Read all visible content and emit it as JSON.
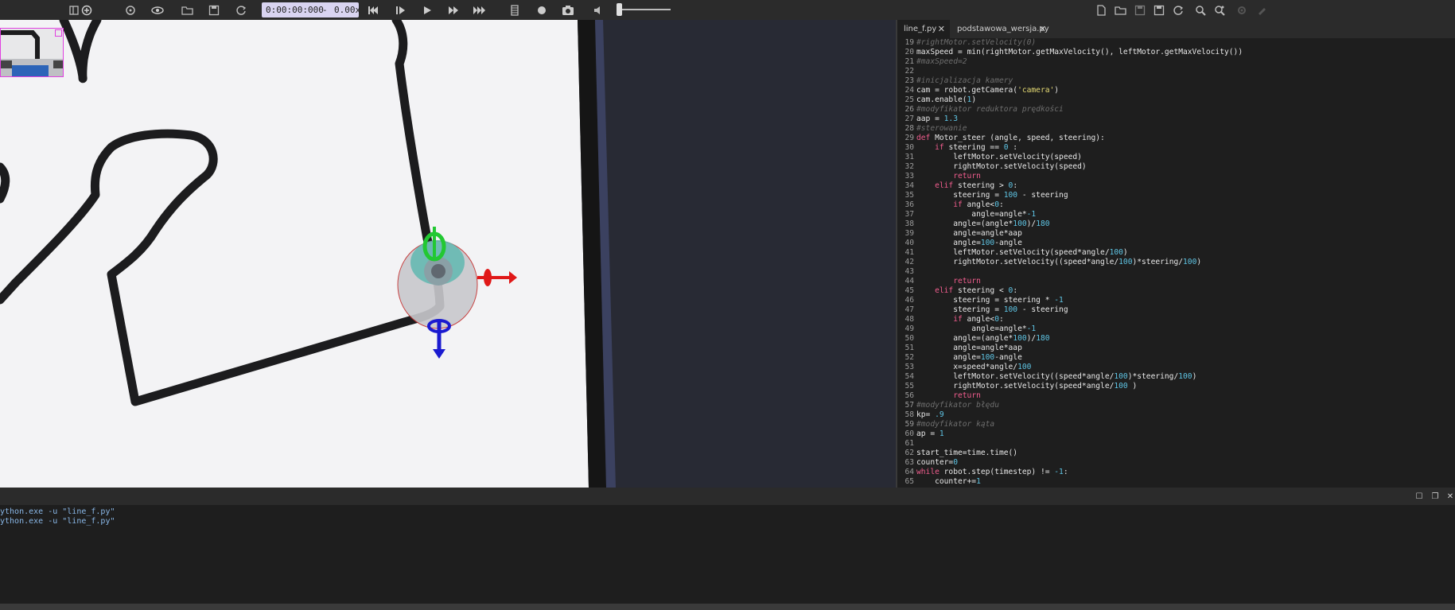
{
  "toolbar": {
    "time_display": "0:00:00:000",
    "time_sep": "-",
    "speed_display": "0.00x"
  },
  "tabs": [
    {
      "label": "line_f.py",
      "active": true
    },
    {
      "label": "podstawowa_wersja.py",
      "active": false
    }
  ],
  "code": [
    {
      "n": "19",
      "parts": [
        {
          "t": "#rightMotor.setVelocity(0)",
          "c": "comment"
        }
      ]
    },
    {
      "n": "20",
      "parts": [
        {
          "t": "maxSpeed = min(rightMotor.getMaxVelocity(), leftMotor.getMaxVelocity())",
          "c": ""
        }
      ]
    },
    {
      "n": "21",
      "parts": [
        {
          "t": "#maxSpeed=2",
          "c": "comment"
        }
      ]
    },
    {
      "n": "22",
      "parts": []
    },
    {
      "n": "23",
      "parts": [
        {
          "t": "#inicjalizacja kamery",
          "c": "comment"
        }
      ]
    },
    {
      "n": "24",
      "parts": [
        {
          "t": "cam = robot.getCamera(",
          "c": ""
        },
        {
          "t": "'camera'",
          "c": "str"
        },
        {
          "t": ")",
          "c": ""
        }
      ]
    },
    {
      "n": "25",
      "parts": [
        {
          "t": "cam.enable(",
          "c": ""
        },
        {
          "t": "1",
          "c": "num"
        },
        {
          "t": ")",
          "c": ""
        }
      ]
    },
    {
      "n": "26",
      "parts": [
        {
          "t": "#modyfikator reduktora prędkości",
          "c": "comment"
        }
      ]
    },
    {
      "n": "27",
      "parts": [
        {
          "t": "aap = ",
          "c": ""
        },
        {
          "t": "1.3",
          "c": "num"
        }
      ]
    },
    {
      "n": "28",
      "parts": [
        {
          "t": "#sterowanie",
          "c": "comment"
        }
      ]
    },
    {
      "n": "29",
      "parts": [
        {
          "t": "def ",
          "c": "kw"
        },
        {
          "t": "Motor_steer (angle, speed, steering):",
          "c": ""
        }
      ]
    },
    {
      "n": "30",
      "parts": [
        {
          "t": "    ",
          "c": ""
        },
        {
          "t": "if ",
          "c": "kw"
        },
        {
          "t": "steering == ",
          "c": ""
        },
        {
          "t": "0",
          "c": "num"
        },
        {
          "t": " :",
          "c": ""
        }
      ]
    },
    {
      "n": "31",
      "parts": [
        {
          "t": "        leftMotor.setVelocity(speed)",
          "c": ""
        }
      ]
    },
    {
      "n": "32",
      "parts": [
        {
          "t": "        rightMotor.setVelocity(speed)",
          "c": ""
        }
      ]
    },
    {
      "n": "33",
      "parts": [
        {
          "t": "        ",
          "c": ""
        },
        {
          "t": "return",
          "c": "kw"
        }
      ]
    },
    {
      "n": "34",
      "parts": [
        {
          "t": "    ",
          "c": ""
        },
        {
          "t": "elif ",
          "c": "kw"
        },
        {
          "t": "steering > ",
          "c": ""
        },
        {
          "t": "0",
          "c": "num"
        },
        {
          "t": ":",
          "c": ""
        }
      ]
    },
    {
      "n": "35",
      "parts": [
        {
          "t": "        steering = ",
          "c": ""
        },
        {
          "t": "100",
          "c": "num"
        },
        {
          "t": " - steering",
          "c": ""
        }
      ]
    },
    {
      "n": "36",
      "parts": [
        {
          "t": "        ",
          "c": ""
        },
        {
          "t": "if ",
          "c": "kw"
        },
        {
          "t": "angle<",
          "c": ""
        },
        {
          "t": "0",
          "c": "num"
        },
        {
          "t": ":",
          "c": ""
        }
      ]
    },
    {
      "n": "37",
      "parts": [
        {
          "t": "            angle=angle*",
          "c": ""
        },
        {
          "t": "-1",
          "c": "num"
        }
      ]
    },
    {
      "n": "38",
      "parts": [
        {
          "t": "        angle=(angle*",
          "c": ""
        },
        {
          "t": "100",
          "c": "num"
        },
        {
          "t": ")/",
          "c": ""
        },
        {
          "t": "180",
          "c": "num"
        }
      ]
    },
    {
      "n": "39",
      "parts": [
        {
          "t": "        angle=angle*aap",
          "c": ""
        }
      ]
    },
    {
      "n": "40",
      "parts": [
        {
          "t": "        angle=",
          "c": ""
        },
        {
          "t": "100",
          "c": "num"
        },
        {
          "t": "-angle",
          "c": ""
        }
      ]
    },
    {
      "n": "41",
      "parts": [
        {
          "t": "        leftMotor.setVelocity(speed*angle/",
          "c": ""
        },
        {
          "t": "100",
          "c": "num"
        },
        {
          "t": ")",
          "c": ""
        }
      ]
    },
    {
      "n": "42",
      "parts": [
        {
          "t": "        rightMotor.setVelocity((speed*angle/",
          "c": ""
        },
        {
          "t": "100",
          "c": "num"
        },
        {
          "t": ")*steering/",
          "c": ""
        },
        {
          "t": "100",
          "c": "num"
        },
        {
          "t": ")",
          "c": ""
        }
      ]
    },
    {
      "n": "43",
      "parts": []
    },
    {
      "n": "44",
      "parts": [
        {
          "t": "        ",
          "c": ""
        },
        {
          "t": "return",
          "c": "kw"
        }
      ]
    },
    {
      "n": "45",
      "parts": [
        {
          "t": "    ",
          "c": ""
        },
        {
          "t": "elif ",
          "c": "kw"
        },
        {
          "t": "steering < ",
          "c": ""
        },
        {
          "t": "0",
          "c": "num"
        },
        {
          "t": ":",
          "c": ""
        }
      ]
    },
    {
      "n": "46",
      "parts": [
        {
          "t": "        steering = steering * ",
          "c": ""
        },
        {
          "t": "-1",
          "c": "num"
        }
      ]
    },
    {
      "n": "47",
      "parts": [
        {
          "t": "        steering = ",
          "c": ""
        },
        {
          "t": "100",
          "c": "num"
        },
        {
          "t": " - steering",
          "c": ""
        }
      ]
    },
    {
      "n": "48",
      "parts": [
        {
          "t": "        ",
          "c": ""
        },
        {
          "t": "if ",
          "c": "kw"
        },
        {
          "t": "angle<",
          "c": ""
        },
        {
          "t": "0",
          "c": "num"
        },
        {
          "t": ":",
          "c": ""
        }
      ]
    },
    {
      "n": "49",
      "parts": [
        {
          "t": "            angle=angle*",
          "c": ""
        },
        {
          "t": "-1",
          "c": "num"
        }
      ]
    },
    {
      "n": "50",
      "parts": [
        {
          "t": "        angle=(angle*",
          "c": ""
        },
        {
          "t": "100",
          "c": "num"
        },
        {
          "t": ")/",
          "c": ""
        },
        {
          "t": "180",
          "c": "num"
        }
      ]
    },
    {
      "n": "51",
      "parts": [
        {
          "t": "        angle=angle*aap",
          "c": ""
        }
      ]
    },
    {
      "n": "52",
      "parts": [
        {
          "t": "        angle=",
          "c": ""
        },
        {
          "t": "100",
          "c": "num"
        },
        {
          "t": "-angle",
          "c": ""
        }
      ]
    },
    {
      "n": "53",
      "parts": [
        {
          "t": "        x=speed*angle/",
          "c": ""
        },
        {
          "t": "100",
          "c": "num"
        }
      ]
    },
    {
      "n": "54",
      "parts": [
        {
          "t": "        leftMotor.setVelocity((speed*angle/",
          "c": ""
        },
        {
          "t": "100",
          "c": "num"
        },
        {
          "t": ")*steering/",
          "c": ""
        },
        {
          "t": "100",
          "c": "num"
        },
        {
          "t": ")",
          "c": ""
        }
      ]
    },
    {
      "n": "55",
      "parts": [
        {
          "t": "        rightMotor.setVelocity(speed*angle/",
          "c": ""
        },
        {
          "t": "100",
          "c": "num"
        },
        {
          "t": " )",
          "c": ""
        }
      ]
    },
    {
      "n": "56",
      "parts": [
        {
          "t": "        ",
          "c": ""
        },
        {
          "t": "return",
          "c": "kw"
        }
      ]
    },
    {
      "n": "57",
      "parts": [
        {
          "t": "#modyfikator błędu",
          "c": "comment"
        }
      ]
    },
    {
      "n": "58",
      "parts": [
        {
          "t": "kp= ",
          "c": ""
        },
        {
          "t": ".9",
          "c": "num"
        }
      ]
    },
    {
      "n": "59",
      "parts": [
        {
          "t": "#modyfikator kąta",
          "c": "comment"
        }
      ]
    },
    {
      "n": "60",
      "parts": [
        {
          "t": "ap = ",
          "c": ""
        },
        {
          "t": "1",
          "c": "num"
        }
      ]
    },
    {
      "n": "61",
      "parts": []
    },
    {
      "n": "62",
      "parts": [
        {
          "t": "start_time=time.time()",
          "c": ""
        }
      ]
    },
    {
      "n": "63",
      "parts": [
        {
          "t": "counter=",
          "c": ""
        },
        {
          "t": "0",
          "c": "num"
        }
      ]
    },
    {
      "n": "64",
      "parts": [
        {
          "t": "while ",
          "c": "kw"
        },
        {
          "t": "robot.step(timestep) != ",
          "c": ""
        },
        {
          "t": "-1",
          "c": "num"
        },
        {
          "t": ":",
          "c": ""
        }
      ]
    },
    {
      "n": "65",
      "parts": [
        {
          "t": "    counter+=",
          "c": ""
        },
        {
          "t": "1",
          "c": "num"
        }
      ]
    }
  ],
  "console": {
    "lines": [
      "ython.exe -u \"line_f.py\"",
      "ython.exe -u \"line_f.py\""
    ]
  },
  "colors": {
    "keyword": "#f15d8e",
    "number": "#5fc6e6",
    "string": "#e6db74",
    "comment": "#6e6e6e",
    "time_box": "#d9d4f1"
  },
  "icons": {
    "toolbar_left": [
      "panel-toggle-icon",
      "add-node-icon",
      "reload-view-icon",
      "eye-icon",
      "open-world-icon",
      "save-world-icon",
      "revert-world-icon"
    ],
    "playback": [
      "step-back-icon",
      "step-icon",
      "play-icon",
      "fast-forward-icon",
      "fastest-icon"
    ],
    "recording": [
      "movie-icon",
      "record-icon",
      "screenshot-icon",
      "volume-icon"
    ],
    "editor": [
      "new-file-icon",
      "open-file-icon",
      "save-file-icon",
      "save-as-icon",
      "revert-file-icon",
      "find-icon",
      "replace-icon",
      "compile-icon",
      "clean-icon"
    ]
  }
}
